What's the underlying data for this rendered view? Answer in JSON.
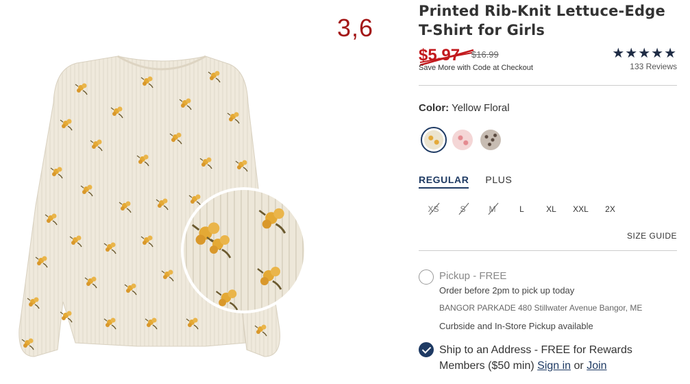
{
  "annotation": "3,6",
  "product": {
    "title_line1": "Printed Rib-Knit Lettuce-Edge",
    "title_line2": "T-Shirt for Girls",
    "sale_price": "$5.97",
    "original_price": "$16.99",
    "save_note": "Save More with Code at Checkout",
    "stars": "★★★★★",
    "rating": 5,
    "reviews": "133 Reviews"
  },
  "color": {
    "label": "Color:",
    "selected": "Yellow Floral",
    "swatches": [
      {
        "name": "Yellow Floral",
        "color": "#e9dcc0",
        "selected": true
      },
      {
        "name": "Pink Floral",
        "color": "#f2c9cb",
        "selected": false
      },
      {
        "name": "Leopard",
        "color": "#b7aaa0",
        "selected": false
      }
    ]
  },
  "fit_tabs": [
    {
      "label": "REGULAR",
      "active": true
    },
    {
      "label": "PLUS",
      "active": false
    }
  ],
  "sizes": [
    {
      "label": "XS",
      "available": false
    },
    {
      "label": "S",
      "available": false
    },
    {
      "label": "M",
      "available": false
    },
    {
      "label": "L",
      "available": true
    },
    {
      "label": "XL",
      "available": true
    },
    {
      "label": "XXL",
      "available": true
    },
    {
      "label": "2X",
      "available": true
    }
  ],
  "size_guide": "SIZE GUIDE",
  "pickup": {
    "title": "Pickup - FREE",
    "order_before": "Order before 2pm to pick up today",
    "store": "BANGOR PARKADE 480 Stillwater Avenue  Bangor, ME",
    "availability": "Curbside and In-Store Pickup available",
    "selected": false
  },
  "ship": {
    "text_before": "Ship to an Address - FREE for Rewards Members ($50 min) ",
    "sign_in": "Sign in",
    "or": " or ",
    "join": "Join",
    "selected": true
  },
  "colors": {
    "sale_red": "#c2191d",
    "navy": "#1e3a63",
    "stars": "#1e2b44",
    "annotation_red": "#a31616"
  }
}
